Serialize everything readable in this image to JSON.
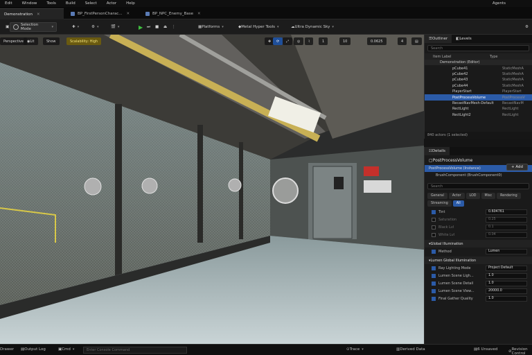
{
  "menu": {
    "items": [
      "Edit",
      "Window",
      "Tools",
      "Build",
      "Select",
      "Actor",
      "Help"
    ],
    "agents": "Agents"
  },
  "tabs": [
    {
      "label": "Demonstration"
    },
    {
      "label": "BP_FirstPersonCharac..."
    },
    {
      "label": "BP_NPC_Enemy_Base"
    }
  ],
  "toolbar": {
    "selection_mode": "Selection Mode",
    "platforms": "Platforms",
    "tool1": "Metal Hyper Tools",
    "tool2": "Ultra Dynamic Sky"
  },
  "viewport": {
    "perspective": "Perspective",
    "lit": "Lit",
    "show": "Show",
    "scalability": "Scalability: High",
    "fov": "1",
    "snap": "10",
    "angle": "0.0625",
    "scale": "4"
  },
  "outliner": {
    "tab": "Outliner",
    "levels_tab": "Levels",
    "search_placeholder": "Search",
    "col_label": "Item Label",
    "col_type": "Type",
    "root": "Demonstration (Editor)",
    "rows": [
      {
        "label": "pCube41",
        "type": "StaticMeshA"
      },
      {
        "label": "pCube42",
        "type": "StaticMeshA"
      },
      {
        "label": "pCube43",
        "type": "StaticMeshA"
      },
      {
        "label": "pCube44",
        "type": "StaticMeshA"
      },
      {
        "label": "PlayerStart",
        "type": "PlayerStart"
      },
      {
        "label": "PostProcessVolume",
        "type": "PostProcessV"
      },
      {
        "label": "RecastNavMesh-Default",
        "type": "RecastNavM"
      },
      {
        "label": "RectLight",
        "type": "RectLight"
      },
      {
        "label": "RectLight2",
        "type": "RectLight"
      }
    ],
    "footer": "840 actors (1 selected)"
  },
  "details": {
    "tab": "Details",
    "actor_name": "PostProcessVolume",
    "add_label": "+ Add",
    "instance": "PostProcessVolume (Instance)",
    "component": "BrushComponent (BrushComponent0)",
    "search_placeholder": "Search",
    "filters": [
      "General",
      "Actor",
      "LOD",
      "Misc",
      "Rendering",
      "Streaming",
      "All"
    ],
    "props_top": [
      {
        "label": "Tint",
        "value": "0.604761",
        "on": true
      },
      {
        "label": "Saturation",
        "value": "0.25",
        "on": false
      },
      {
        "label": "Black Lvl",
        "value": "0.1",
        "on": false
      },
      {
        "label": "White Lvl",
        "value": "0.04",
        "on": false
      }
    ],
    "section_gi": "Global Illumination",
    "method_label": "Method",
    "method_value": "Lumen",
    "section_lumen": "Lumen Global Illumination",
    "props_lumen": [
      {
        "label": "Ray Lighting Mode",
        "value": "Project Default"
      },
      {
        "label": "Lumen Scene Ligh...",
        "value": "1.0"
      },
      {
        "label": "Lumen Scene Detail",
        "value": "1.0"
      },
      {
        "label": "Lumen Scene View...",
        "value": "20000.0"
      },
      {
        "label": "Final Gather Quality",
        "value": "1.0"
      }
    ]
  },
  "statusbar": {
    "drawer": "Drawer",
    "output": "Output Log",
    "cmd": "Cmd",
    "cmd_placeholder": "Enter Console Command",
    "trace": "Trace",
    "derived": "Derived Data",
    "unsaved": "6 Unsaved",
    "revision": "Revision Control"
  },
  "colors": {
    "accent": "#2b5ba8",
    "play": "#3fbf3f",
    "warn": "#6a5a10"
  }
}
